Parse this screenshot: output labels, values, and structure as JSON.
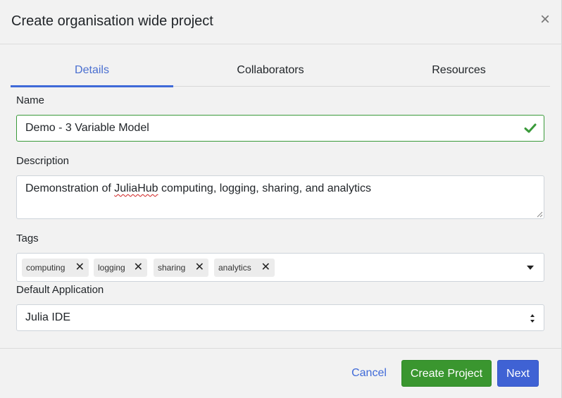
{
  "modal": {
    "title": "Create organisation wide project",
    "close_label": "×"
  },
  "tabs": [
    {
      "label": "Details",
      "active": true
    },
    {
      "label": "Collaborators",
      "active": false
    },
    {
      "label": "Resources",
      "active": false
    }
  ],
  "form": {
    "name": {
      "label": "Name",
      "value": "Demo - 3 Variable Model"
    },
    "description": {
      "label": "Description",
      "value_before": "Demonstration of ",
      "value_misspelled": "JuliaHub",
      "value_after": " computing, logging, sharing, and analytics"
    },
    "tags": {
      "label": "Tags",
      "items": [
        "computing",
        "logging",
        "sharing",
        "analytics"
      ],
      "remove_glyph": "✕"
    },
    "default_application": {
      "label": "Default Application",
      "value": "Julia IDE"
    }
  },
  "footer": {
    "cancel_label": "Cancel",
    "create_label": "Create Project",
    "next_label": "Next"
  },
  "colors": {
    "accent": "#3f6ad8",
    "success": "#3a962f",
    "valid_border": "#3a9a3a"
  }
}
